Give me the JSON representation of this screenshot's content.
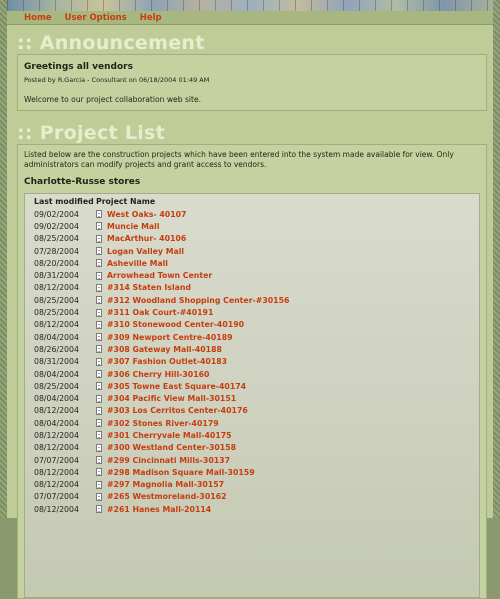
{
  "menu": {
    "home": "Home",
    "user_options": "User Options",
    "help": "Help"
  },
  "announcement": {
    "heading": ":: Announcement",
    "title": "Greetings all vendors",
    "posted": "Posted by R.Garcia - Consultant on 06/18/2004 01:49 AM",
    "body": "Welcome to our project collaboration web site."
  },
  "project_list": {
    "heading": ":: Project List",
    "intro": "Listed below are the construction projects which have been entered into the system made available for view. Only administrators can modify projects and grant access to vendors.",
    "group": "Charlotte-Russe stores",
    "columns": {
      "modified": "Last modified",
      "name": "Project Name"
    },
    "rows": [
      {
        "date": "09/02/2004",
        "name": "West Oaks- 40107"
      },
      {
        "date": "09/02/2004",
        "name": "Muncie Mall"
      },
      {
        "date": "08/25/2004",
        "name": "MacArthur- 40106"
      },
      {
        "date": "07/28/2004",
        "name": "Logan Valley Mall"
      },
      {
        "date": "08/20/2004",
        "name": "Asheville Mall"
      },
      {
        "date": "08/31/2004",
        "name": "Arrowhead Town Center"
      },
      {
        "date": "08/12/2004",
        "name": "#314 Staten Island"
      },
      {
        "date": "08/25/2004",
        "name": "#312 Woodland Shopping Center-#30156"
      },
      {
        "date": "08/25/2004",
        "name": "#311 Oak Court-#40191"
      },
      {
        "date": "08/12/2004",
        "name": "#310 Stonewood Center-40190"
      },
      {
        "date": "08/04/2004",
        "name": "#309 Newport Centre-40189"
      },
      {
        "date": "08/26/2004",
        "name": "#308 Gateway Mall-40188"
      },
      {
        "date": "08/31/2004",
        "name": "#307 Fashion Outlet-40183"
      },
      {
        "date": "08/04/2004",
        "name": "#306 Cherry Hill-30160"
      },
      {
        "date": "08/25/2004",
        "name": "#305 Towne East Square-40174"
      },
      {
        "date": "08/04/2004",
        "name": "#304 Pacific View Mall-30151"
      },
      {
        "date": "08/12/2004",
        "name": "#303 Los Cerritos Center-40176"
      },
      {
        "date": "08/04/2004",
        "name": "#302 Stones River-40179"
      },
      {
        "date": "08/12/2004",
        "name": "#301 Cherryvale Mall-40175"
      },
      {
        "date": "08/12/2004",
        "name": "#300 Westland Center-30158"
      },
      {
        "date": "07/07/2004",
        "name": "#299 Cincinnati Mills-30137"
      },
      {
        "date": "08/12/2004",
        "name": "#298 Madison Square Mall-30159"
      },
      {
        "date": "08/12/2004",
        "name": "#297 Magnolia Mall-30157"
      },
      {
        "date": "07/07/2004",
        "name": "#265 Westmoreland-30162"
      },
      {
        "date": "08/12/2004",
        "name": "#261 Hanes Mall-20114"
      }
    ]
  }
}
